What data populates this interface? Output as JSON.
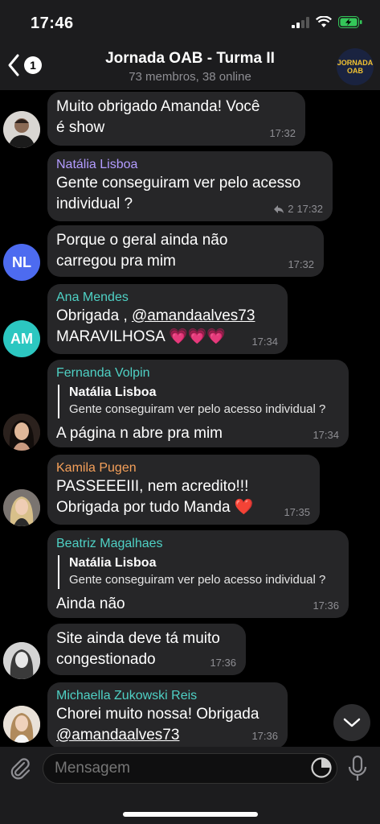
{
  "status": {
    "time": "17:46"
  },
  "header": {
    "back_badge": "1",
    "title": "Jornada OAB - Turma II",
    "subtitle": "73 membros, 38 online",
    "avatar_text_top": "JORNADA",
    "avatar_text_bottom": "OAB"
  },
  "messages": [
    {
      "text": "Muito obrigado Amanda! Você é show",
      "time": "17:32"
    },
    {
      "sender": "Natália Lisboa",
      "sender_color": "#b39cff",
      "text": "Gente conseguiram ver pelo acesso individual ?",
      "replies": "2",
      "time": "17:32"
    },
    {
      "avatar": "NL",
      "text": "Porque o geral ainda não carregou pra mim",
      "time": "17:32"
    },
    {
      "sender": "Ana Mendes",
      "sender_color": "#4fd1c5",
      "avatar": "AM",
      "text_prefix": "Obrigada , ",
      "mention": "@amandaalves73",
      "text_line2": "MARAVILHOSA 💗💗💗",
      "time": "17:34"
    },
    {
      "sender": "Fernanda Volpin",
      "sender_color": "#4fd1c5",
      "reply_name": "Natália Lisboa",
      "reply_text": "Gente conseguiram ver pelo acesso individual ?",
      "text": "A página n abre pra mim",
      "time": "17:34"
    },
    {
      "sender": "Kamila Pugen",
      "sender_color": "#f5a05a",
      "text": "PASSEEEIII, nem acredito!!!",
      "text_line2": "Obrigada por tudo Manda ❤️",
      "time": "17:35"
    },
    {
      "sender": "Beatriz Magalhaes",
      "sender_color": "#4fd1c5",
      "reply_name": "Natália Lisboa",
      "reply_text": "Gente conseguiram ver pelo acesso individual ?",
      "text": "Ainda não",
      "time": "17:36"
    },
    {
      "text": "Site ainda deve tá muito congestionado",
      "time": "17:36"
    },
    {
      "sender": "Michaella Zukowski Reis",
      "sender_color": "#4fd1c5",
      "text": "Chorei muito nossa! Obrigada",
      "mention": "@amandaalves73",
      "time": "17:36"
    }
  ],
  "composer": {
    "placeholder": "Mensagem"
  },
  "colors": {
    "avatar_nl": "#4d6bf0",
    "avatar_am": "#2cc7c1",
    "bubble": "#262628"
  }
}
